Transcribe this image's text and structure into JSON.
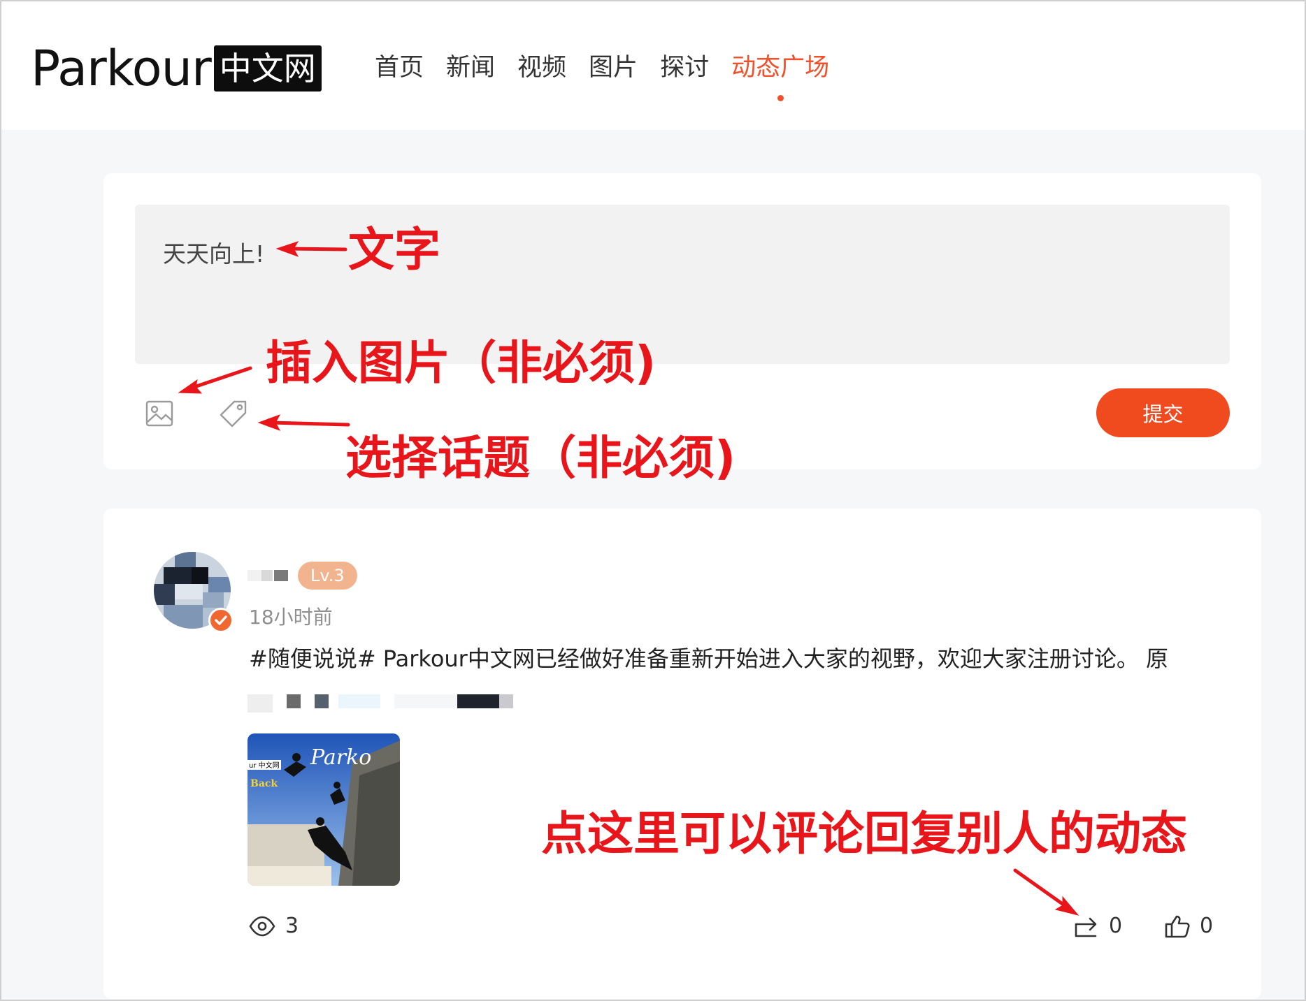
{
  "header": {
    "logo_main": "Parkour",
    "logo_box": "中文网",
    "nav": [
      {
        "label": "首页",
        "active": false
      },
      {
        "label": "新闻",
        "active": false
      },
      {
        "label": "视频",
        "active": false
      },
      {
        "label": "图片",
        "active": false
      },
      {
        "label": "探讨",
        "active": false
      },
      {
        "label": "动态广场",
        "active": true
      }
    ]
  },
  "composer": {
    "text_value": "天天向上!",
    "icons": [
      "image-icon",
      "tag-icon"
    ],
    "submit_label": "提交"
  },
  "post": {
    "level": "Lv.3",
    "time": "18小时前",
    "text": "#随便说说# Parkour中文网已经做好准备重新开始进入大家的视野，欢迎大家注册讨论。 原",
    "image_caption": "Parkour 中文网",
    "image_overlay": "Back",
    "views": "3",
    "shares": "0",
    "likes": "0"
  },
  "annotations": {
    "text": "文字",
    "image": "插入图片（非必须)",
    "topic": "选择话题（非必须)",
    "comment": "点这里可以评论回复别人的动态"
  },
  "colors": {
    "accent": "#f04a1f",
    "annotation": "#e8151a",
    "level_badge": "#f2b48e"
  }
}
